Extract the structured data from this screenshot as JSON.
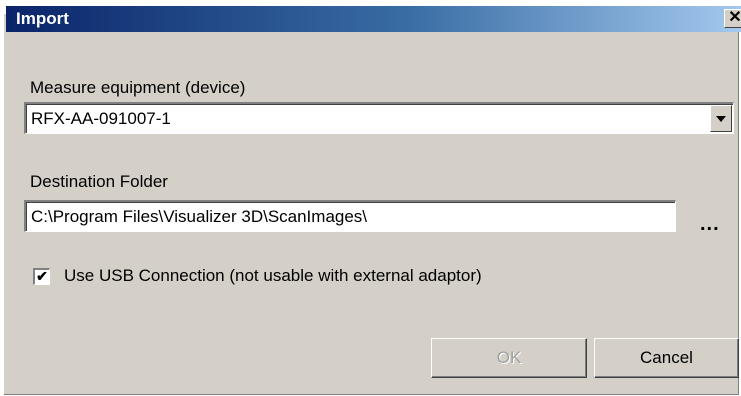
{
  "window": {
    "title": "Import",
    "close_glyph": "✕"
  },
  "device": {
    "label": "Measure equipment (device)",
    "selected": "RFX-AA-091007-1"
  },
  "destination": {
    "label": "Destination Folder",
    "value": "C:\\Program Files\\Visualizer 3D\\ScanImages\\",
    "browse_label": "..."
  },
  "usb": {
    "checked": true,
    "check_glyph": "✔",
    "label": "Use USB Connection (not usable with external adaptor)"
  },
  "buttons": {
    "ok_label": "OK",
    "cancel_label": "Cancel"
  },
  "colors": {
    "title_start": "#0a246a",
    "title_end": "#a6caf0",
    "face": "#d4d0c8"
  }
}
